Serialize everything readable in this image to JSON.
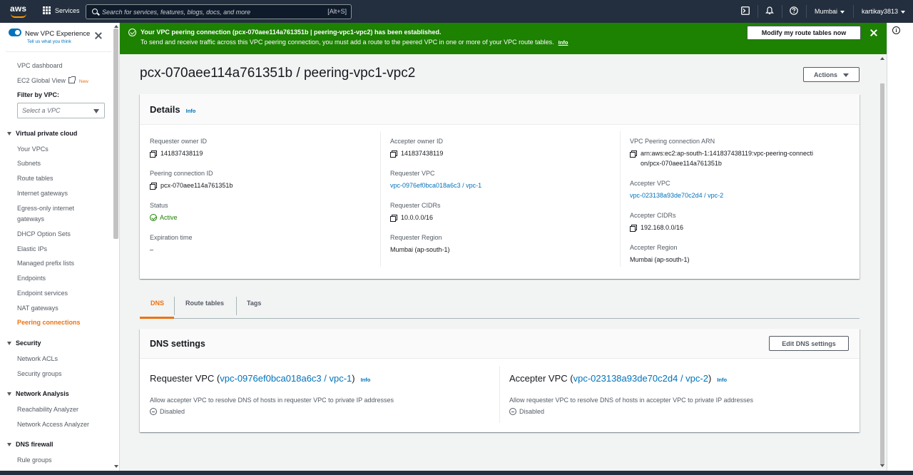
{
  "topnav": {
    "logo_text": "aws",
    "services_label": "Services",
    "search_placeholder": "Search for services, features, blogs, docs, and more",
    "search_shortcut": "[Alt+S]",
    "region": "Mumbai",
    "user": "kartikay3813",
    "icons": [
      "cloudshell-icon",
      "bell-icon",
      "help-icon"
    ]
  },
  "sidebar": {
    "new_vpc_label": "New VPC Experience",
    "tell_us": "Tell us what you think",
    "vpc_dashboard": "VPC dashboard",
    "ec2_global_view": "EC2 Global View",
    "new_badge": "New",
    "filter_label": "Filter by VPC:",
    "filter_placeholder": "Select a VPC",
    "sections": [
      {
        "title": "Virtual private cloud",
        "items": [
          "Your VPCs",
          "Subnets",
          "Route tables",
          "Internet gateways",
          "Egress-only internet",
          "gateways",
          "DHCP Option Sets",
          "Elastic IPs",
          "Managed prefix lists",
          "Endpoints",
          "Endpoint services",
          "NAT gateways",
          "Peering connections"
        ]
      },
      {
        "title": "Security",
        "items": [
          "Network ACLs",
          "Security groups"
        ]
      },
      {
        "title": "Network Analysis",
        "items": [
          "Reachability Analyzer",
          "Network Access Analyzer"
        ]
      },
      {
        "title": "DNS firewall",
        "items": [
          "Rule groups"
        ]
      }
    ]
  },
  "banner": {
    "title": "Your VPC peering connection (pcx-070aee114a761351b | peering-vpc1-vpc2) has been established.",
    "body": "To send and receive traffic across this VPC peering connection, you must add a route to the peered VPC in one or more of your VPC route tables.",
    "info": "Info",
    "button": "Modify my route tables now",
    "color": "#1d8102"
  },
  "page": {
    "title": "pcx-070aee114a761351b / peering-vpc1-vpc2",
    "actions": "Actions"
  },
  "details": {
    "title": "Details",
    "info": "Info",
    "requester_owner_label": "Requester owner ID",
    "requester_owner_value": "141837438119",
    "peering_id_label": "Peering connection ID",
    "peering_id_value": "pcx-070aee114a761351b",
    "status_label": "Status",
    "status_value": "Active",
    "expiration_label": "Expiration time",
    "expiration_value": "–",
    "accepter_owner_label": "Accepter owner ID",
    "accepter_owner_value": "141837438119",
    "requester_vpc_label": "Requester VPC",
    "requester_vpc_value": "vpc-0976ef0bca018a6c3 / vpc-1",
    "requester_cidrs_label": "Requester CIDRs",
    "requester_cidrs_value": "10.0.0.0/16",
    "requester_region_label": "Requester Region",
    "requester_region_value": "Mumbai (ap-south-1)",
    "arn_label": "VPC Peering connection ARN",
    "arn_value": "arn:aws:ec2:ap-south-1:141837438119:vpc-peering-connection/pcx-070aee114a761351b",
    "accepter_vpc_label": "Accepter VPC",
    "accepter_vpc_value": "vpc-023138a93de70c2d4 / vpc-2",
    "accepter_cidrs_label": "Accepter CIDRs",
    "accepter_cidrs_value": "192.168.0.0/16",
    "accepter_region_label": "Accepter Region",
    "accepter_region_value": "Mumbai (ap-south-1)"
  },
  "tabs": [
    "DNS",
    "Route tables",
    "Tags"
  ],
  "dns": {
    "title": "DNS settings",
    "edit_button": "Edit DNS settings",
    "requester_prefix": "Requester VPC (",
    "requester_link": "vpc-0976ef0bca018a6c3 / vpc-1",
    "requester_desc": "Allow accepter VPC to resolve DNS of hosts in requester VPC to private IP addresses",
    "requester_status": "Disabled",
    "accepter_prefix": "Accepter VPC (",
    "accepter_link": "vpc-023138a93de70c2d4 / vpc-2",
    "accepter_desc": "Allow requester VPC to resolve DNS of hosts in accepter VPC to private IP addresses",
    "accepter_status": "Disabled",
    "close_paren": ")",
    "info": "Info"
  },
  "colors": {
    "accent": "#ec7211",
    "link": "#0073bb",
    "success": "#1d8102",
    "nav": "#232f3e"
  }
}
